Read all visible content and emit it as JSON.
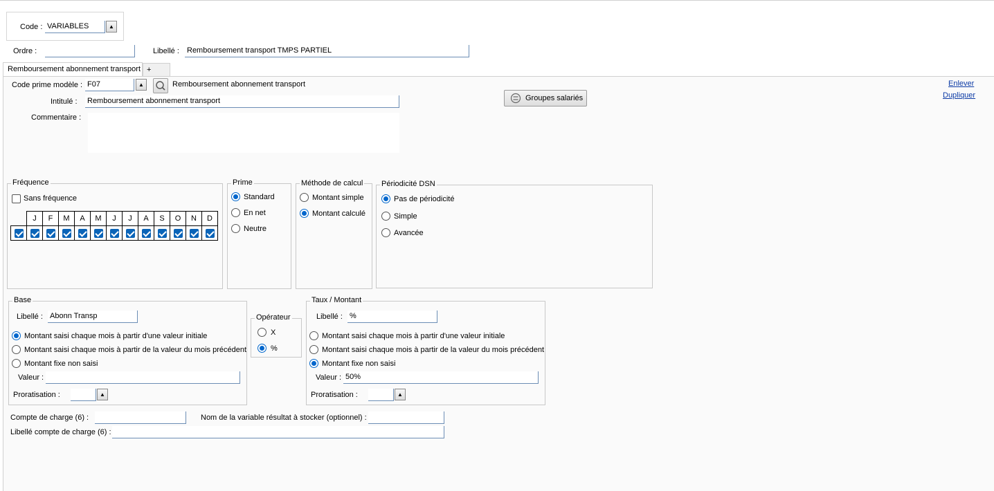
{
  "header": {
    "code_label": "Code :",
    "code_value": "VARIABLES",
    "ordre_label": "Ordre :",
    "ordre_value": "",
    "libelle_label": "Libellé :",
    "libelle_value": "Remboursement transport TMPS PARTIEL"
  },
  "tabs": [
    {
      "label": "Remboursement abonnement transport"
    },
    {
      "label": "+"
    }
  ],
  "prime": {
    "code_label": "Code prime modèle :",
    "code_value": "F07",
    "code_desc": "Remboursement abonnement transport",
    "intitule_label": "Intitulé :",
    "intitule_value": "Remboursement abonnement transport",
    "commentaire_label": "Commentaire :",
    "commentaire_value": "",
    "groupes_button": "Groupes salariés",
    "enlever_link": "Enlever",
    "dupliquer_link": "Dupliquer"
  },
  "frequence": {
    "title": "Fréquence",
    "sans_label": "Sans fréquence",
    "sans_checked": false,
    "months": [
      "J",
      "F",
      "M",
      "A",
      "M",
      "J",
      "J",
      "A",
      "S",
      "O",
      "N",
      "D"
    ],
    "months_checked": [
      true,
      true,
      true,
      true,
      true,
      true,
      true,
      true,
      true,
      true,
      true,
      true
    ]
  },
  "prime_type": {
    "title": "Prime",
    "options": [
      "Standard",
      "En net",
      "Neutre"
    ],
    "selected": 0
  },
  "methode": {
    "title": "Méthode de calcul",
    "options": [
      "Montant simple",
      "Montant calculé"
    ],
    "selected": 1
  },
  "periodicite": {
    "title": "Périodicité DSN",
    "options": [
      "Pas de périodicité",
      "Simple",
      "Avancée"
    ],
    "selected": 0
  },
  "base": {
    "title": "Base",
    "libelle_label": "Libellé :",
    "libelle_value": "Abonn Transp",
    "options": [
      "Montant saisi chaque mois à partir d'une valeur initiale",
      "Montant saisi chaque mois à partir de la valeur du mois précédent",
      "Montant fixe non saisi"
    ],
    "selected": 0,
    "valeur_label": "Valeur :",
    "valeur_value": "",
    "proratisation_label": "Proratisation :",
    "proratisation_value": ""
  },
  "operateur": {
    "title": "Opérateur",
    "options": [
      "X",
      "%"
    ],
    "selected": 1
  },
  "taux": {
    "title": "Taux / Montant",
    "libelle_label": "Libellé :",
    "libelle_value": "%",
    "options": [
      "Montant saisi chaque mois à partir d'une valeur initiale",
      "Montant saisi chaque mois à partir de la valeur du mois précédent",
      "Montant fixe non saisi"
    ],
    "selected": 2,
    "valeur_label": "Valeur :",
    "valeur_value": "50%",
    "proratisation_label": "Proratisation :",
    "proratisation_value": ""
  },
  "footer": {
    "compte_label": "Compte de charge (6) :",
    "compte_value": "",
    "variable_label": "Nom de la variable résultat à stocker (optionnel) :",
    "variable_value": "",
    "libelle_compte_label": "Libellé compte de charge (6) :",
    "libelle_compte_value": ""
  },
  "icons": {
    "spin_up": "spin-up-icon",
    "search": "search-icon",
    "groupes": "groupes-icon"
  }
}
